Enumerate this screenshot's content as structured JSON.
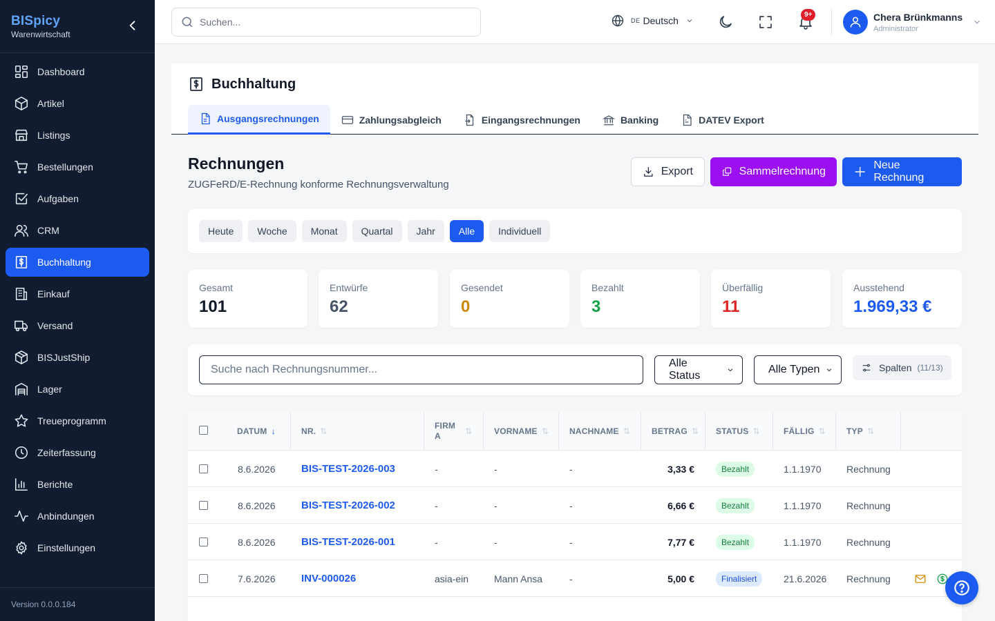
{
  "app": {
    "name": "BISpicy",
    "subtitle": "Warenwirtschaft",
    "version": "Version 0.0.0.184",
    "accent": "#1d5bf0"
  },
  "sidebar": {
    "items": [
      {
        "label": "Dashboard",
        "icon": "dashboard-icon"
      },
      {
        "label": "Artikel",
        "icon": "box-icon"
      },
      {
        "label": "Listings",
        "icon": "store-icon"
      },
      {
        "label": "Bestellungen",
        "icon": "cart-icon"
      },
      {
        "label": "Aufgaben",
        "icon": "checkbox-icon"
      },
      {
        "label": "CRM",
        "icon": "users-icon"
      },
      {
        "label": "Buchhaltung",
        "icon": "dollar-receipt-icon",
        "active": true
      },
      {
        "label": "Einkauf",
        "icon": "building-icon"
      },
      {
        "label": "Versand",
        "icon": "truck-icon"
      },
      {
        "label": "BISJustShip",
        "icon": "package-icon"
      },
      {
        "label": "Lager",
        "icon": "warehouse-icon"
      },
      {
        "label": "Treueprogramm",
        "icon": "star-icon"
      },
      {
        "label": "Zeiterfassung",
        "icon": "clock-icon"
      },
      {
        "label": "Berichte",
        "icon": "bar-chart-icon"
      },
      {
        "label": "Anbindungen",
        "icon": "activity-icon"
      },
      {
        "label": "Einstellungen",
        "icon": "gear-icon"
      }
    ]
  },
  "topbar": {
    "search_placeholder": "Suchen...",
    "lang_code": "DE",
    "lang_name": "Deutsch",
    "notification_badge": "9+",
    "user_name": "Chera Brünkmanns",
    "user_role": "Administrator"
  },
  "page": {
    "title": "Buchhaltung",
    "tabs": [
      {
        "label": "Ausgangsrechnungen",
        "icon": "document-icon",
        "active": true
      },
      {
        "label": "Zahlungsabgleich",
        "icon": "credit-card-icon"
      },
      {
        "label": "Eingangsrechnungen",
        "icon": "file-import-icon"
      },
      {
        "label": "Banking",
        "icon": "bank-icon"
      },
      {
        "label": "DATEV Export",
        "icon": "file-text-icon"
      }
    ]
  },
  "section": {
    "title": "Rechnungen",
    "subtitle": "ZUGFeRD/E-Rechnung konforme Rechnungsverwaltung",
    "export_label": "Export",
    "sammel_label": "Sammelrechnung",
    "new_label": "Neue Rechnung"
  },
  "periods": [
    "Heute",
    "Woche",
    "Monat",
    "Quartal",
    "Jahr",
    "Alle",
    "Individuell"
  ],
  "active_period": "Alle",
  "stats": [
    {
      "label": "Gesamt",
      "value": "101",
      "color": "#111827"
    },
    {
      "label": "Entwürfe",
      "value": "62",
      "color": "#475569"
    },
    {
      "label": "Gesendet",
      "value": "0",
      "color": "#ca8a04"
    },
    {
      "label": "Bezahlt",
      "value": "3",
      "color": "#16a34a"
    },
    {
      "label": "Überfällig",
      "value": "11",
      "color": "#dc2626"
    },
    {
      "label": "Ausstehend",
      "value": "1.969,33 €",
      "color": "#1d5bf0"
    }
  ],
  "filters": {
    "search_placeholder": "Suche nach Rechnungsnummer...",
    "status_value": "Alle Status",
    "type_value": "Alle Typen",
    "columns_label": "Spalten",
    "columns_count": "(11/13)"
  },
  "table": {
    "headers": {
      "datum": "DATUM",
      "nr": "NR.",
      "firma_1": "FIRM",
      "firma_2": "A",
      "vorname": "VORNAME",
      "nachname": "NACHNAME",
      "betrag": "BETRAG",
      "status": "STATUS",
      "faellig": "FÄLLIG",
      "typ": "TYP"
    },
    "rows": [
      {
        "datum": "8.6.2026",
        "nr": "BIS-TEST-2026-003",
        "firma": "-",
        "vorname": "-",
        "nachname": "-",
        "betrag": "3,33 €",
        "status": "Bezahlt",
        "faellig": "1.1.1970",
        "typ": "Rechnung"
      },
      {
        "datum": "8.6.2026",
        "nr": "BIS-TEST-2026-002",
        "firma": "-",
        "vorname": "-",
        "nachname": "-",
        "betrag": "6,66 €",
        "status": "Bezahlt",
        "faellig": "1.1.1970",
        "typ": "Rechnung"
      },
      {
        "datum": "8.6.2026",
        "nr": "BIS-TEST-2026-001",
        "firma": "-",
        "vorname": "-",
        "nachname": "-",
        "betrag": "7,77 €",
        "status": "Bezahlt",
        "faellig": "1.1.1970",
        "typ": "Rechnung"
      },
      {
        "datum": "7.6.2026",
        "nr": "INV-000026",
        "firma": "asia-ein",
        "vorname": "Mann Ansa",
        "nachname": "-",
        "betrag": "5,00 €",
        "status": "Finalisiert",
        "faellig": "21.6.2026",
        "typ": "Rechnung"
      }
    ]
  }
}
